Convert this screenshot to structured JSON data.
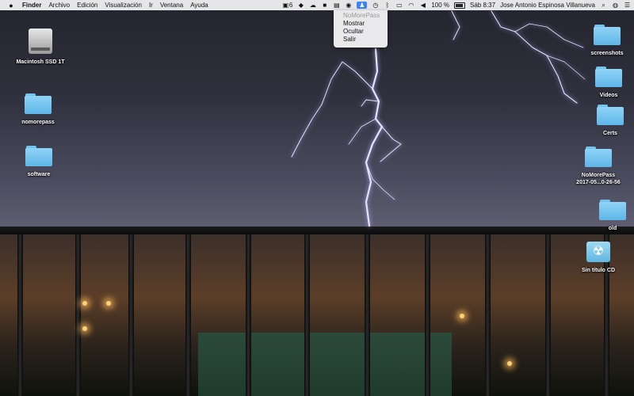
{
  "menubar": {
    "app_name": "Finder",
    "menus": [
      "Archivo",
      "Edición",
      "Visualización",
      "Ir",
      "Ventana",
      "Ayuda"
    ],
    "status": {
      "extension_count": "6",
      "battery_text": "100 %",
      "datetime": "Sáb 8:37",
      "user_name": "Jose Antonio Espinosa Villanueva"
    }
  },
  "dropdown": {
    "title": "NoMorePass",
    "items": [
      "Mostrar",
      "Ocultar",
      "Salir"
    ]
  },
  "desktop": {
    "left_icons": [
      {
        "label": "Macintosh SSD 1T",
        "type": "disk"
      },
      {
        "label": "nomorepass",
        "type": "folder"
      },
      {
        "label": "software",
        "type": "folder"
      }
    ],
    "right_icons": [
      {
        "label": "screenshots",
        "type": "folder"
      },
      {
        "label": "Videos",
        "type": "folder"
      },
      {
        "label": "Certs",
        "type": "folder"
      },
      {
        "label": "NoMorePass",
        "label2": "2017-05...0-26-56",
        "type": "folder"
      },
      {
        "label": "old",
        "type": "folder"
      },
      {
        "label": "Sin título CD",
        "type": "cd"
      }
    ]
  },
  "colors": {
    "folder": "#6ec0ee",
    "menubar": "#ececee",
    "accent": "#3a82f6"
  }
}
